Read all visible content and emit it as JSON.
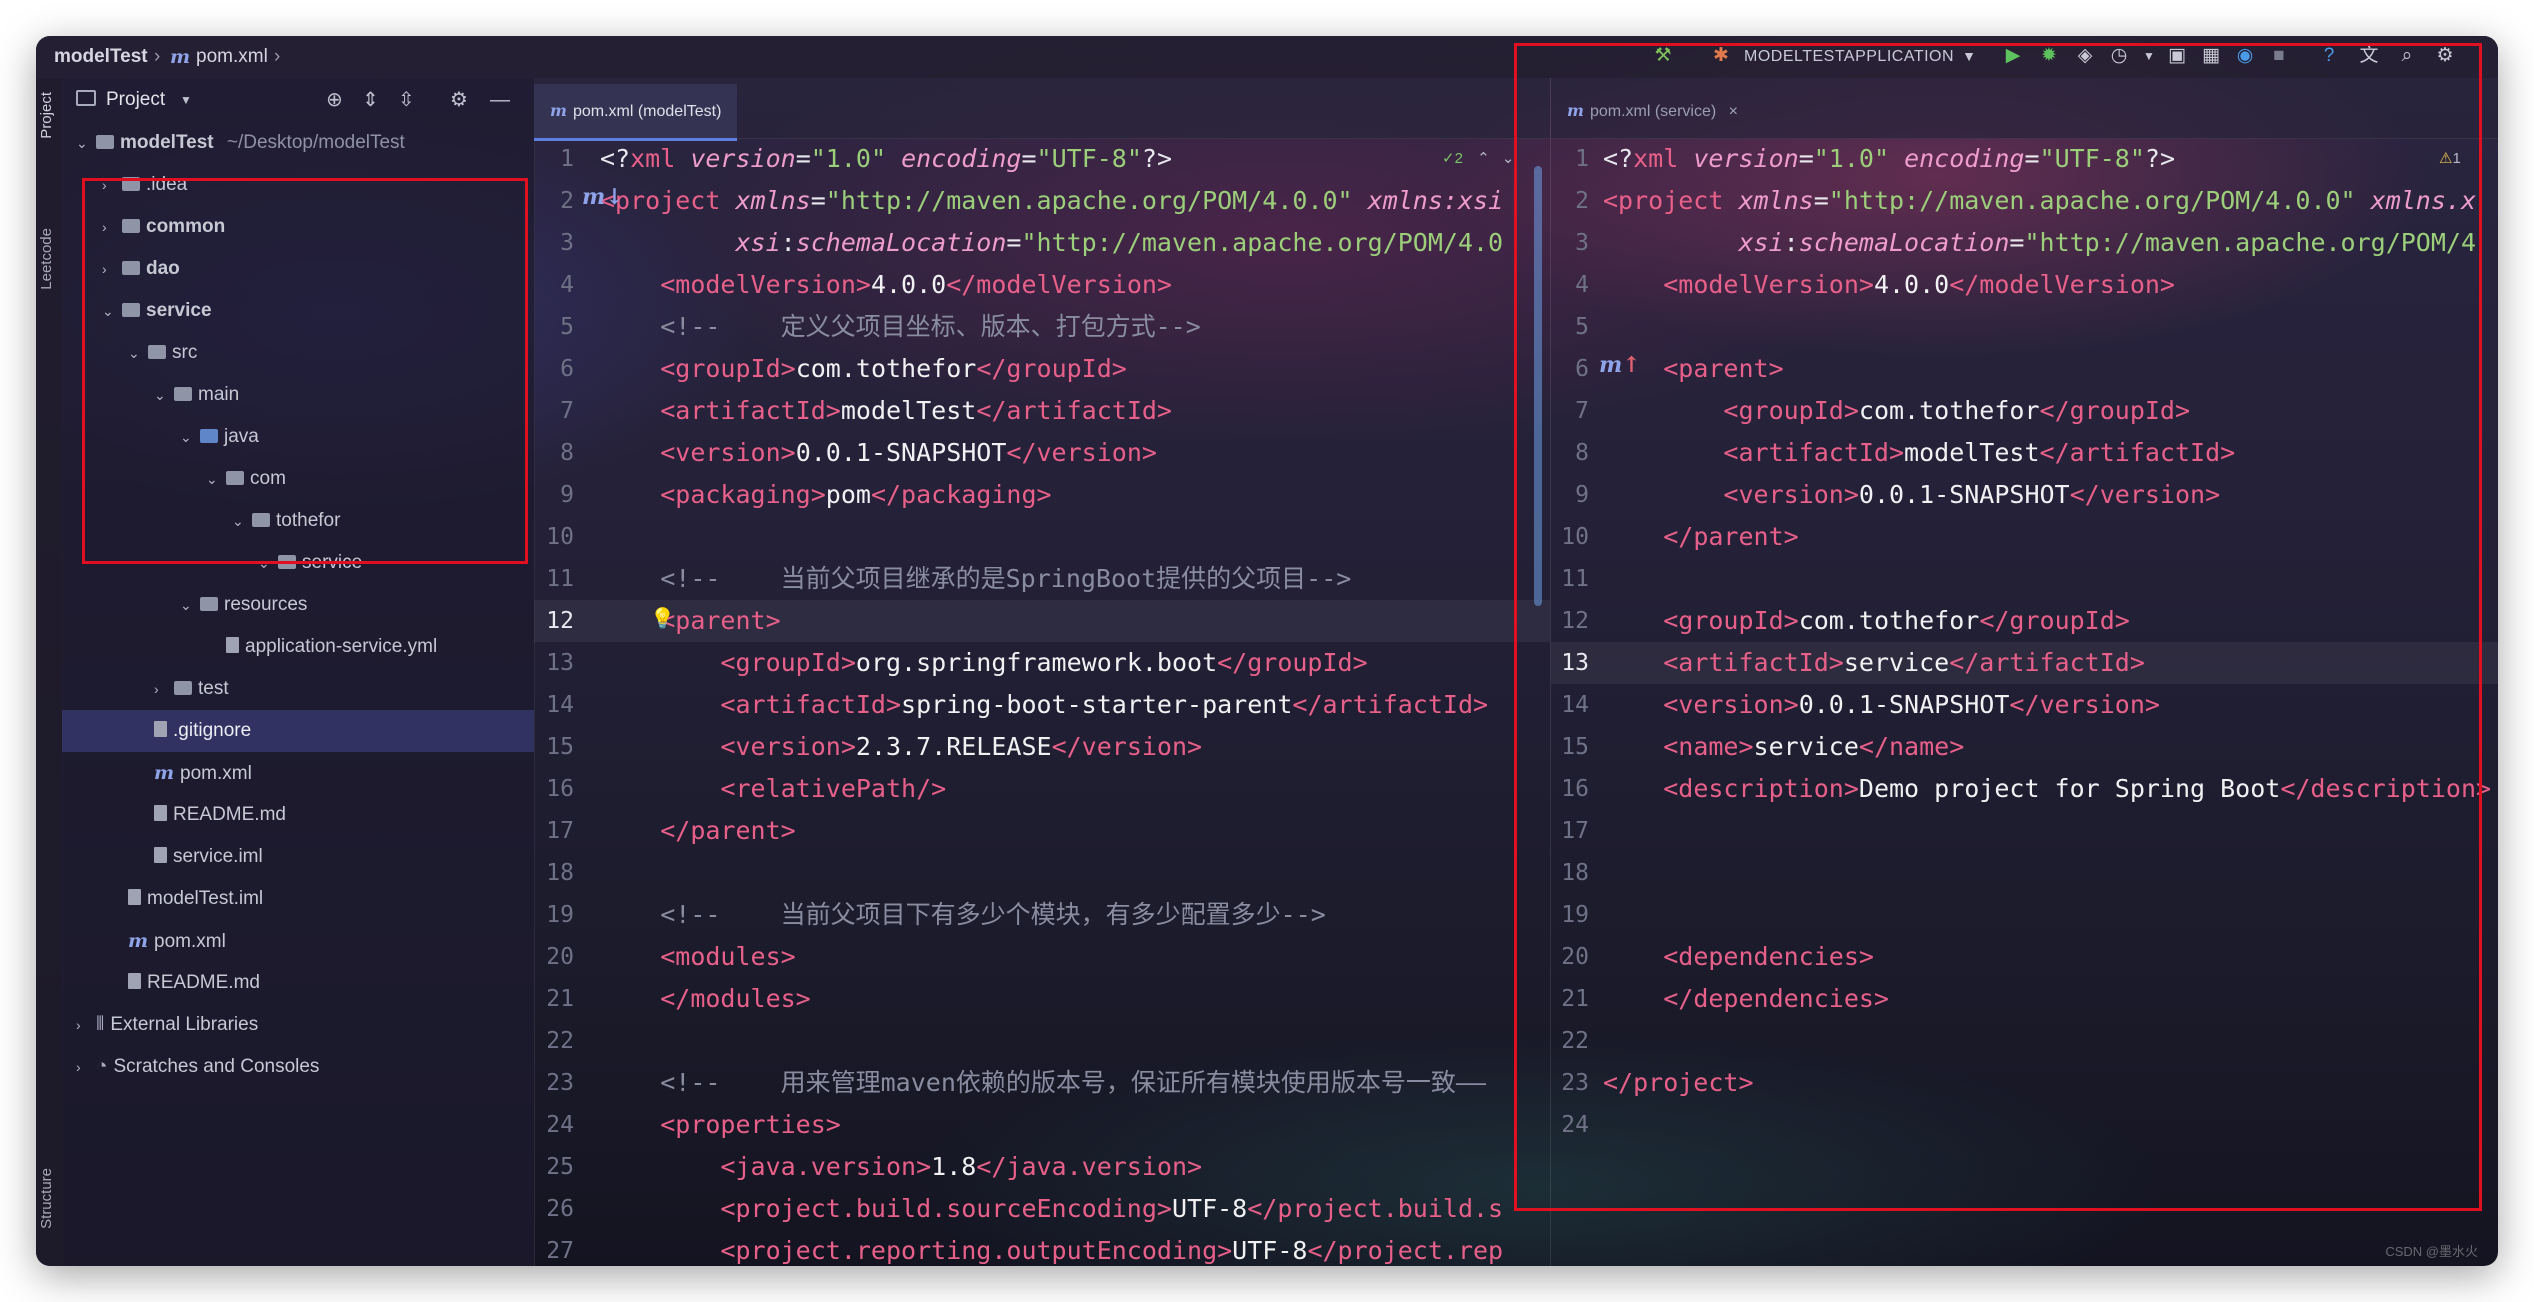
{
  "breadcrumb": {
    "project": "modelTest",
    "file": "pom.xml"
  },
  "run_config": {
    "label": "MODELTESTAPPLICATION"
  },
  "tool_stripe": {
    "top_label": "Project",
    "mid_label": "Leetcode",
    "bottom_label": "Structure"
  },
  "project_panel": {
    "title": "Project",
    "tree": [
      {
        "label": "modelTest",
        "hint": "~/Desktop/modelTest",
        "kind": "module"
      },
      {
        "label": ".idea",
        "kind": "folder"
      },
      {
        "label": "common",
        "kind": "module"
      },
      {
        "label": "dao",
        "kind": "module"
      },
      {
        "label": "service",
        "kind": "module"
      },
      {
        "label": "src",
        "kind": "folder"
      },
      {
        "label": "main",
        "kind": "folder"
      },
      {
        "label": "java",
        "kind": "folder-blue"
      },
      {
        "label": "com",
        "kind": "folder"
      },
      {
        "label": "tothefor",
        "kind": "folder"
      },
      {
        "label": "service",
        "kind": "folder"
      },
      {
        "label": "resources",
        "kind": "folder"
      },
      {
        "label": "application-service.yml",
        "kind": "file"
      },
      {
        "label": "test",
        "kind": "folder"
      },
      {
        "label": ".gitignore",
        "kind": "file"
      },
      {
        "label": "pom.xml",
        "kind": "maven"
      },
      {
        "label": "README.md",
        "kind": "file"
      },
      {
        "label": "service.iml",
        "kind": "file"
      },
      {
        "label": "modelTest.iml",
        "kind": "file"
      },
      {
        "label": "pom.xml",
        "kind": "maven"
      },
      {
        "label": "README.md",
        "kind": "file"
      },
      {
        "label": "External Libraries",
        "kind": "lib"
      },
      {
        "label": "Scratches and Consoles",
        "kind": "scratch"
      }
    ]
  },
  "left_editor": {
    "tab_label": "pom.xml (modelTest)",
    "inspection_count": "2",
    "current_line": 12,
    "lines": [
      [
        [
          "p",
          "<?"
        ],
        [
          "t",
          "xml "
        ],
        [
          "a",
          "version"
        ],
        [
          "p",
          "="
        ],
        [
          "v",
          "\"1.0\" "
        ],
        [
          "a",
          "encoding"
        ],
        [
          "p",
          "="
        ],
        [
          "v",
          "\"UTF-8\""
        ],
        [
          "p",
          "?>"
        ]
      ],
      [
        [
          "t",
          "<project "
        ],
        [
          "a",
          "xmlns"
        ],
        [
          "p",
          "="
        ],
        [
          "v",
          "\"http://maven.apache.org/POM/4.0.0\" "
        ],
        [
          "a",
          "xmlns:xsi"
        ]
      ],
      [
        [
          "tx",
          "         "
        ],
        [
          "a",
          "xsi"
        ],
        [
          "p",
          ":"
        ],
        [
          "a",
          "schemaLocation"
        ],
        [
          "p",
          "="
        ],
        [
          "v",
          "\"http://maven.apache.org/POM/4.0"
        ]
      ],
      [
        [
          "tx",
          "    "
        ],
        [
          "t",
          "<modelVersion>"
        ],
        [
          "tx",
          "4.0.0"
        ],
        [
          "t",
          "</modelVersion>"
        ]
      ],
      [
        [
          "tx",
          "    "
        ],
        [
          "c",
          "<!--    定义父项目坐标、版本、打包方式-->"
        ]
      ],
      [
        [
          "tx",
          "    "
        ],
        [
          "t",
          "<groupId>"
        ],
        [
          "tx",
          "com.tothefor"
        ],
        [
          "t",
          "</groupId>"
        ]
      ],
      [
        [
          "tx",
          "    "
        ],
        [
          "t",
          "<artifactId>"
        ],
        [
          "tx",
          "modelTest"
        ],
        [
          "t",
          "</artifactId>"
        ]
      ],
      [
        [
          "tx",
          "    "
        ],
        [
          "t",
          "<version>"
        ],
        [
          "tx",
          "0.0.1-SNAPSHOT"
        ],
        [
          "t",
          "</version>"
        ]
      ],
      [
        [
          "tx",
          "    "
        ],
        [
          "t",
          "<packaging>"
        ],
        [
          "tx",
          "pom"
        ],
        [
          "t",
          "</packaging>"
        ]
      ],
      [],
      [
        [
          "tx",
          "    "
        ],
        [
          "c",
          "<!--    当前父项目继承的是SpringBoot提供的父项目-->"
        ]
      ],
      [
        [
          "tx",
          "    "
        ],
        [
          "t",
          "<parent>"
        ]
      ],
      [
        [
          "tx",
          "        "
        ],
        [
          "t",
          "<groupId>"
        ],
        [
          "tx",
          "org.springframework.boot"
        ],
        [
          "t",
          "</groupId>"
        ]
      ],
      [
        [
          "tx",
          "        "
        ],
        [
          "t",
          "<artifactId>"
        ],
        [
          "tx",
          "spring-boot-starter-parent"
        ],
        [
          "t",
          "</artifactId>"
        ]
      ],
      [
        [
          "tx",
          "        "
        ],
        [
          "t",
          "<version>"
        ],
        [
          "tx",
          "2.3.7.RELEASE"
        ],
        [
          "t",
          "</version>"
        ]
      ],
      [
        [
          "tx",
          "        "
        ],
        [
          "t",
          "<relativePath/>"
        ]
      ],
      [
        [
          "tx",
          "    "
        ],
        [
          "t",
          "</parent>"
        ]
      ],
      [],
      [
        [
          "tx",
          "    "
        ],
        [
          "c",
          "<!--    当前父项目下有多少个模块，有多少配置多少-->"
        ]
      ],
      [
        [
          "tx",
          "    "
        ],
        [
          "t",
          "<modules>"
        ]
      ],
      [
        [
          "tx",
          "    "
        ],
        [
          "t",
          "</modules>"
        ]
      ],
      [],
      [
        [
          "tx",
          "    "
        ],
        [
          "c",
          "<!--    用来管理maven依赖的版本号，保证所有模块使用版本号一致——"
        ]
      ],
      [
        [
          "tx",
          "    "
        ],
        [
          "t",
          "<properties>"
        ]
      ],
      [
        [
          "tx",
          "        "
        ],
        [
          "t",
          "<java.version>"
        ],
        [
          "tx",
          "1.8"
        ],
        [
          "t",
          "</java.version>"
        ]
      ],
      [
        [
          "tx",
          "        "
        ],
        [
          "t",
          "<project.build.sourceEncoding>"
        ],
        [
          "tx",
          "UTF-8"
        ],
        [
          "t",
          "</project.build.s"
        ]
      ],
      [
        [
          "tx",
          "        "
        ],
        [
          "t",
          "<project.reporting.outputEncoding>"
        ],
        [
          "tx",
          "UTF-8"
        ],
        [
          "t",
          "</project.rep"
        ]
      ]
    ]
  },
  "right_editor": {
    "tab_label": "pom.xml (service)",
    "inspection_count": "1",
    "current_line": 13,
    "lines": [
      [
        [
          "p",
          "<?"
        ],
        [
          "t",
          "xml "
        ],
        [
          "a",
          "version"
        ],
        [
          "p",
          "="
        ],
        [
          "v",
          "\"1.0\" "
        ],
        [
          "a",
          "encoding"
        ],
        [
          "p",
          "="
        ],
        [
          "v",
          "\"UTF-8\""
        ],
        [
          "p",
          "?>"
        ]
      ],
      [
        [
          "t",
          "<project "
        ],
        [
          "a",
          "xmlns"
        ],
        [
          "p",
          "="
        ],
        [
          "v",
          "\"http://maven.apache.org/POM/4.0.0\" "
        ],
        [
          "a",
          "xmlns.x"
        ]
      ],
      [
        [
          "tx",
          "         "
        ],
        [
          "a",
          "xsi"
        ],
        [
          "p",
          ":"
        ],
        [
          "a",
          "schemaLocation"
        ],
        [
          "p",
          "="
        ],
        [
          "v",
          "\"http://maven.apache.org/POM/4"
        ]
      ],
      [
        [
          "tx",
          "    "
        ],
        [
          "t",
          "<modelVersion>"
        ],
        [
          "tx",
          "4.0.0"
        ],
        [
          "t",
          "</modelVersion>"
        ]
      ],
      [],
      [
        [
          "tx",
          "    "
        ],
        [
          "t",
          "<parent>"
        ]
      ],
      [
        [
          "tx",
          "        "
        ],
        [
          "t",
          "<groupId>"
        ],
        [
          "tx",
          "com.tothefor"
        ],
        [
          "t",
          "</groupId>"
        ]
      ],
      [
        [
          "tx",
          "        "
        ],
        [
          "t",
          "<artifactId>"
        ],
        [
          "tx",
          "modelTest"
        ],
        [
          "t",
          "</artifactId>"
        ]
      ],
      [
        [
          "tx",
          "        "
        ],
        [
          "t",
          "<version>"
        ],
        [
          "tx",
          "0.0.1-SNAPSHOT"
        ],
        [
          "t",
          "</version>"
        ]
      ],
      [
        [
          "tx",
          "    "
        ],
        [
          "t",
          "</parent>"
        ]
      ],
      [],
      [
        [
          "tx",
          "    "
        ],
        [
          "t",
          "<groupId>"
        ],
        [
          "tx",
          "com.tothefor"
        ],
        [
          "t",
          "</groupId>"
        ]
      ],
      [
        [
          "tx",
          "    "
        ],
        [
          "t",
          "<artifactId>"
        ],
        [
          "tx",
          "service"
        ],
        [
          "t",
          "</artifactId>"
        ]
      ],
      [
        [
          "tx",
          "    "
        ],
        [
          "t",
          "<version>"
        ],
        [
          "tx",
          "0.0.1-SNAPSHOT"
        ],
        [
          "t",
          "</version>"
        ]
      ],
      [
        [
          "tx",
          "    "
        ],
        [
          "t",
          "<name>"
        ],
        [
          "tx",
          "service"
        ],
        [
          "t",
          "</name>"
        ]
      ],
      [
        [
          "tx",
          "    "
        ],
        [
          "t",
          "<description>"
        ],
        [
          "tx",
          "Demo project for Spring Boot"
        ],
        [
          "t",
          "</description>"
        ]
      ],
      [],
      [],
      [],
      [
        [
          "tx",
          "    "
        ],
        [
          "t",
          "<dependencies>"
        ]
      ],
      [
        [
          "tx",
          "    "
        ],
        [
          "t",
          "</dependencies>"
        ]
      ],
      [],
      [
        [
          "t",
          "</project>"
        ]
      ],
      []
    ]
  },
  "colors": {
    "tag": "#e8608a",
    "attr": "#ee9ccc",
    "value": "#9ccf7a",
    "text": "#f1f1f4",
    "comment": "#8a8ca0",
    "highlight_box": "#e01020"
  },
  "watermark": "CSDN @墨水火"
}
